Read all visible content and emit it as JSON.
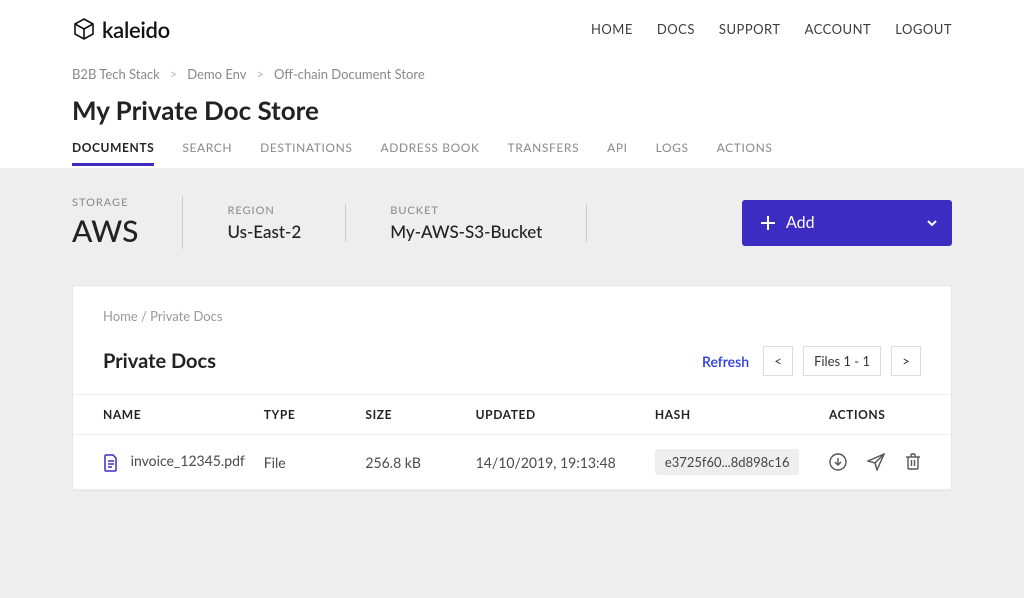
{
  "brand": "kaleido",
  "topnav": {
    "home": "HOME",
    "docs": "DOCS",
    "support": "SUPPORT",
    "account": "ACCOUNT",
    "logout": "LOGOUT"
  },
  "breadcrumbs": {
    "a": "B2B Tech Stack",
    "b": "Demo Env",
    "c": "Off-chain Document Store"
  },
  "page_title": "My Private Doc Store",
  "tabs": {
    "documents": "DOCUMENTS",
    "search": "SEARCH",
    "destinations": "DESTINATIONS",
    "address_book": "ADDRESS BOOK",
    "transfers": "TRANSFERS",
    "api": "API",
    "logs": "LOGS",
    "actions": "ACTIONS"
  },
  "storage": {
    "storage_label": "STORAGE",
    "storage_value": "AWS",
    "region_label": "REGION",
    "region_value": "Us-East-2",
    "bucket_label": "BUCKET",
    "bucket_value": "My-AWS-S3-Bucket"
  },
  "add_button": "Add",
  "panel": {
    "crumb": "Home / Private Docs",
    "title": "Private Docs",
    "refresh": "Refresh",
    "pager_prev": "<",
    "pager_label": "Files 1 - 1",
    "pager_next": ">",
    "columns": {
      "name": "NAME",
      "type": "TYPE",
      "size": "SIZE",
      "updated": "UPDATED",
      "hash": "HASH",
      "actions": "ACTIONS"
    },
    "row": {
      "name": "invoice_12345.pdf",
      "type": "File",
      "size": "256.8 kB",
      "updated": "14/10/2019, 19:13:48",
      "hash": "e3725f60...8d898c16"
    }
  }
}
